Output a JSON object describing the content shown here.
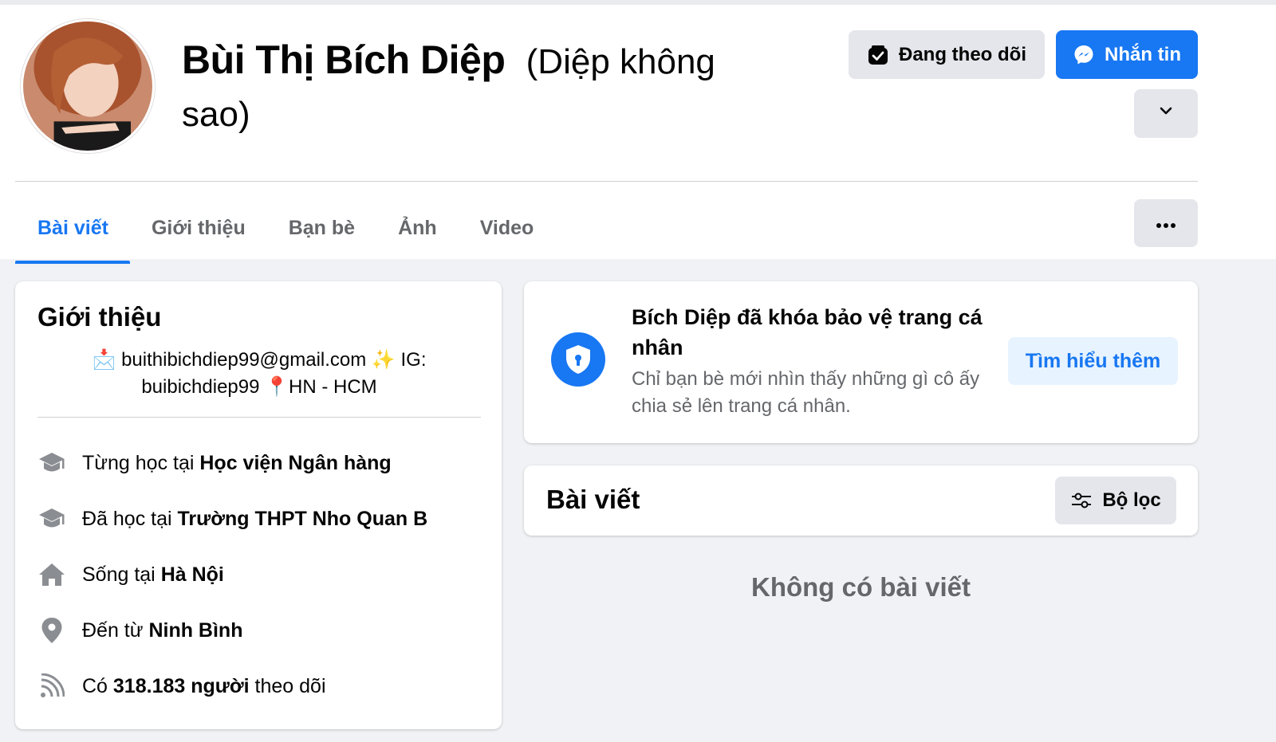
{
  "profile": {
    "name": "Bùi Thị Bích Diệp",
    "alt_name": "(Diệp không sao)"
  },
  "actions": {
    "following_label": "Đang theo dõi",
    "message_label": "Nhắn tin"
  },
  "tabs": [
    {
      "label": "Bài viết",
      "active": true
    },
    {
      "label": "Giới thiệu",
      "active": false
    },
    {
      "label": "Bạn bè",
      "active": false
    },
    {
      "label": "Ảnh",
      "active": false
    },
    {
      "label": "Video",
      "active": false
    }
  ],
  "intro": {
    "title": "Giới thiệu",
    "bio_line1": "📩 buithibichdiep99@gmail.com ✨ IG:",
    "bio_line2": "buibichdiep99 📍HN - HCM",
    "items": [
      {
        "icon": "education-icon",
        "prefix": "Từng học tại ",
        "value": "Học viện Ngân hàng",
        "suffix": ""
      },
      {
        "icon": "education-icon",
        "prefix": "Đã học tại ",
        "value": "Trường THPT Nho Quan B",
        "suffix": ""
      },
      {
        "icon": "home-icon",
        "prefix": "Sống tại ",
        "value": "Hà Nội",
        "suffix": ""
      },
      {
        "icon": "location-icon",
        "prefix": "Đến từ ",
        "value": "Ninh Bình",
        "suffix": ""
      },
      {
        "icon": "followers-icon",
        "prefix": "Có ",
        "value": "318.183 người",
        "suffix": " theo dõi"
      }
    ]
  },
  "locked": {
    "title": "Bích Diệp đã khóa bảo vệ trang cá nhân",
    "subtitle": "Chỉ bạn bè mới nhìn thấy những gì cô ấy chia sẻ lên trang cá nhân.",
    "learn_more_label": "Tìm hiểu thêm"
  },
  "posts": {
    "title": "Bài viết",
    "filter_label": "Bộ lọc",
    "empty_text": "Không có bài viết"
  },
  "colors": {
    "accent": "#1877f2",
    "page_bg": "#f0f2f5",
    "secondary_text": "#65676b"
  }
}
